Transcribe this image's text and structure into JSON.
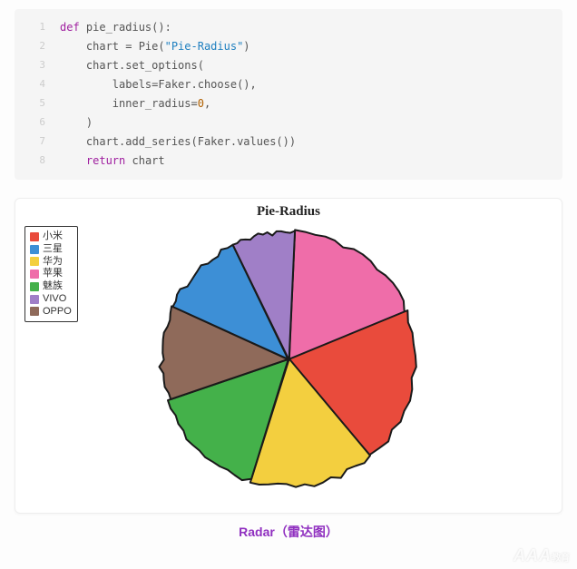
{
  "code": {
    "lines": [
      "def pie_radius():",
      "    chart = Pie(\"Pie-Radius\")",
      "    chart.set_options(",
      "        labels=Faker.choose(),",
      "        inner_radius=0,",
      "    )",
      "    chart.add_series(Faker.values())",
      "    return chart"
    ]
  },
  "chart_data": {
    "type": "pie",
    "title": "Pie-Radius",
    "legend_position": "left",
    "series": [
      {
        "name": "小米",
        "value": 20,
        "color": "#e94b3c"
      },
      {
        "name": "三星",
        "value": 11,
        "color": "#3d8fd6"
      },
      {
        "name": "华为",
        "value": 16,
        "color": "#f3cf3f"
      },
      {
        "name": "苹果",
        "value": 18,
        "color": "#ef6da9"
      },
      {
        "name": "魅族",
        "value": 15,
        "color": "#44b14a"
      },
      {
        "name": "VIVO",
        "value": 8,
        "color": "#a07fc7"
      },
      {
        "name": "OPPO",
        "value": 12,
        "color": "#8f6a5a"
      }
    ]
  },
  "footer": {
    "link_text": "Radar（雷达图）"
  },
  "watermark": "AAA"
}
